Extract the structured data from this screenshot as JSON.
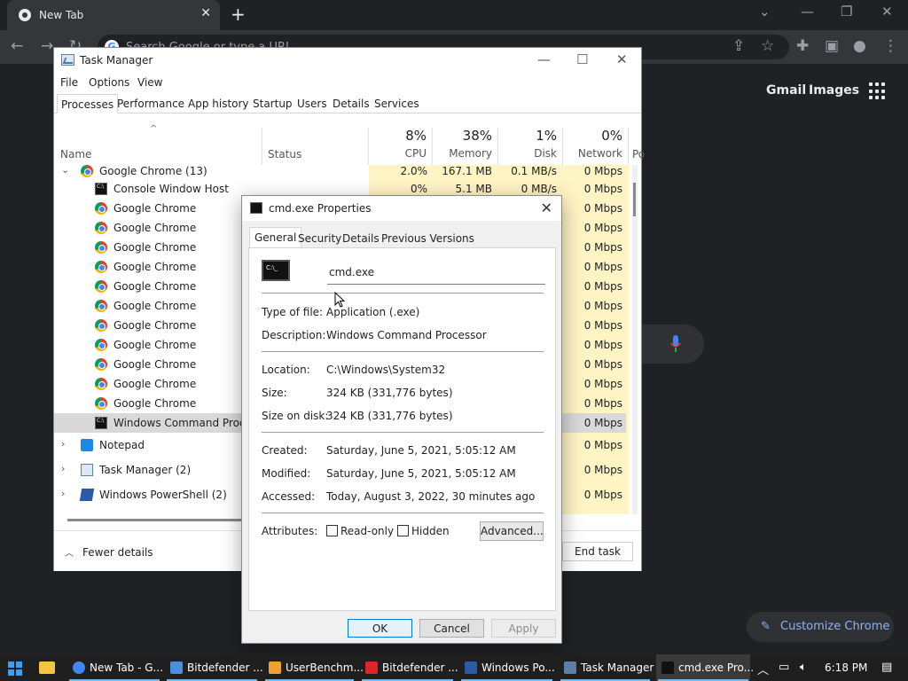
{
  "chrome": {
    "tab_title": "New Tab",
    "omnibox_placeholder": "Search Google or type a URL",
    "gmail": "Gmail",
    "images": "Images",
    "customize": "Customize Chrome"
  },
  "task_manager": {
    "title": "Task Manager",
    "menu": [
      "File",
      "Options",
      "View"
    ],
    "tabs": [
      "Processes",
      "Performance",
      "App history",
      "Startup",
      "Users",
      "Details",
      "Services"
    ],
    "active_tab": "Processes",
    "columns": {
      "name": "Name",
      "status": "Status",
      "cpu": {
        "pct": "8%",
        "label": "CPU"
      },
      "memory": {
        "pct": "38%",
        "label": "Memory"
      },
      "disk": {
        "pct": "1%",
        "label": "Disk"
      },
      "network": {
        "pct": "0%",
        "label": "Network"
      },
      "power": "Po"
    },
    "rows": [
      {
        "name": "Google Chrome (13)",
        "cpu": "2.0%",
        "memory": "167.1 MB",
        "disk": "0.1 MB/s",
        "network": "0 Mbps"
      },
      {
        "name": "Console Window Host",
        "cpu": "0%",
        "memory": "5.1 MB",
        "disk": "0 MB/s",
        "network": "0 Mbps"
      },
      {
        "name": "Google Chrome",
        "network": "0 Mbps"
      },
      {
        "name": "Google Chrome",
        "network": "0 Mbps"
      },
      {
        "name": "Google Chrome",
        "network": "0 Mbps"
      },
      {
        "name": "Google Chrome",
        "network": "0 Mbps"
      },
      {
        "name": "Google Chrome",
        "network": "0 Mbps"
      },
      {
        "name": "Google Chrome",
        "network": "0 Mbps"
      },
      {
        "name": "Google Chrome",
        "network": "0 Mbps"
      },
      {
        "name": "Google Chrome",
        "network": "0 Mbps"
      },
      {
        "name": "Google Chrome",
        "network": "0 Mbps"
      },
      {
        "name": "Google Chrome",
        "network": "0 Mbps"
      },
      {
        "name": "Google Chrome",
        "network": "0 Mbps"
      },
      {
        "name": "Windows Command Proces",
        "network": "0 Mbps"
      },
      {
        "name": "Notepad",
        "network": "0 Mbps"
      },
      {
        "name": "Task Manager (2)",
        "network": "0 Mbps"
      },
      {
        "name": "Windows PowerShell (2)",
        "network": "0 Mbps"
      }
    ],
    "fewer_details": "Fewer details",
    "end_task": "End task"
  },
  "properties": {
    "title": "cmd.exe Properties",
    "tabs": [
      "General",
      "Security",
      "Details",
      "Previous Versions"
    ],
    "active_tab": "General",
    "file_name": "cmd.exe",
    "type_label": "Type of file:",
    "type_value": "Application (.exe)",
    "desc_label": "Description:",
    "desc_value": "Windows Command Processor",
    "location_label": "Location:",
    "location_value": "C:\\Windows\\System32",
    "size_label": "Size:",
    "size_value": "324 KB (331,776 bytes)",
    "size_disk_label": "Size on disk:",
    "size_disk_value": "324 KB (331,776 bytes)",
    "created_label": "Created:",
    "created_value": "Saturday, June 5, 2021, 5:05:12 AM",
    "modified_label": "Modified:",
    "modified_value": "Saturday, June 5, 2021, 5:05:12 AM",
    "accessed_label": "Accessed:",
    "accessed_value": "Today, August 3, 2022, 30 minutes ago",
    "attributes_label": "Attributes:",
    "readonly": "Read-only",
    "hidden": "Hidden",
    "advanced": "Advanced...",
    "ok": "OK",
    "cancel": "Cancel",
    "apply": "Apply"
  },
  "taskbar": {
    "items": [
      "New Tab - G...",
      "Bitdefender ...",
      "UserBenchm...",
      "Bitdefender ...",
      "Windows Po...",
      "Task Manager",
      "cmd.exe Pro..."
    ],
    "clock": "6:18 PM"
  }
}
